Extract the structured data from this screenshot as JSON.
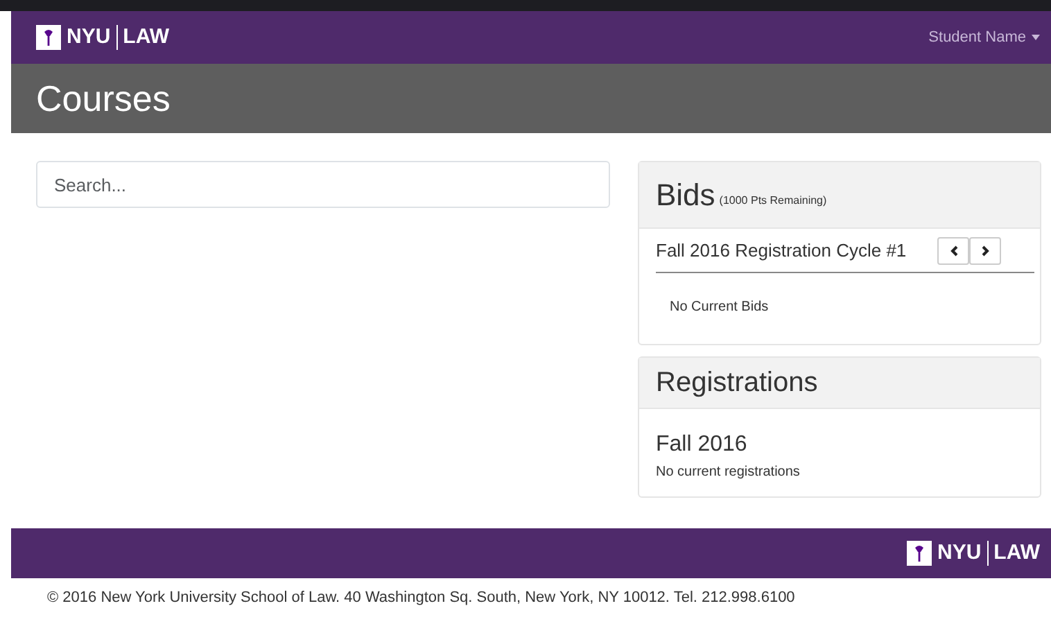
{
  "navbar": {
    "logo": {
      "left": "NYU",
      "right": "LAW"
    },
    "user_menu": "Student Name"
  },
  "page_title": "Courses",
  "search": {
    "placeholder": "Search..."
  },
  "bids": {
    "title": "Bids",
    "remaining": "(1000 Pts Remaining)",
    "cycle": "Fall 2016 Registration Cycle #1",
    "empty": "No Current Bids"
  },
  "registrations": {
    "title": "Registrations",
    "term": "Fall 2016",
    "empty": "No current registrations"
  },
  "footer": {
    "logo": {
      "left": "NYU",
      "right": "LAW"
    },
    "copyright": "© 2016 New York University School of Law. 40 Washington Sq. South, New York, NY 10012. Tel. 212.998.6100"
  }
}
